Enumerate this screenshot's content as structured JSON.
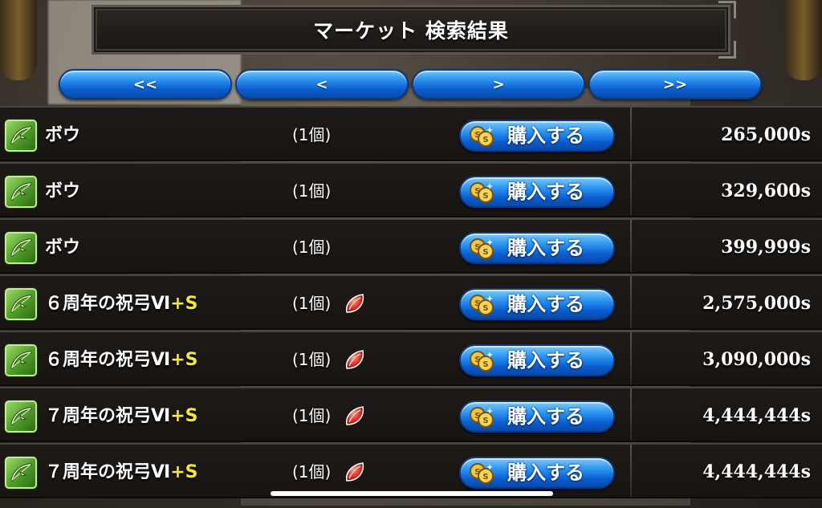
{
  "header": {
    "title": "マーケット 検索結果"
  },
  "pager": {
    "first_label": "<<",
    "prev_label": "<",
    "next_label": ">",
    "last_label": ">>"
  },
  "listings": [
    {
      "name": "ボウ",
      "suffix": "",
      "quantity": "(1個)",
      "rare": false,
      "buy_label": "購入する",
      "price": "265,000s"
    },
    {
      "name": "ボウ",
      "suffix": "",
      "quantity": "(1個)",
      "rare": false,
      "buy_label": "購入する",
      "price": "329,600s"
    },
    {
      "name": "ボウ",
      "suffix": "",
      "quantity": "(1個)",
      "rare": false,
      "buy_label": "購入する",
      "price": "399,999s"
    },
    {
      "name": "６周年の祝弓Ⅵ",
      "suffix": "+S",
      "quantity": "(1個)",
      "rare": true,
      "buy_label": "購入する",
      "price": "2,575,000s"
    },
    {
      "name": "６周年の祝弓Ⅵ",
      "suffix": "+S",
      "quantity": "(1個)",
      "rare": true,
      "buy_label": "購入する",
      "price": "3,090,000s"
    },
    {
      "name": "７周年の祝弓Ⅵ",
      "suffix": "+S",
      "quantity": "(1個)",
      "rare": true,
      "buy_label": "購入する",
      "price": "4,444,444s"
    },
    {
      "name": "７周年の祝弓Ⅵ",
      "suffix": "+S",
      "quantity": "(1個)",
      "rare": true,
      "buy_label": "購入する",
      "price": "4,444,444s"
    }
  ],
  "icons": {
    "item": "bow-icon",
    "rare": "red-gem-icon",
    "buy": "coin-icon"
  },
  "colors": {
    "button_blue": "#2a8ff0",
    "suffix_yellow": "#f4e640",
    "item_icon_green": "#4c9a28",
    "rare_red": "#d8322a"
  }
}
